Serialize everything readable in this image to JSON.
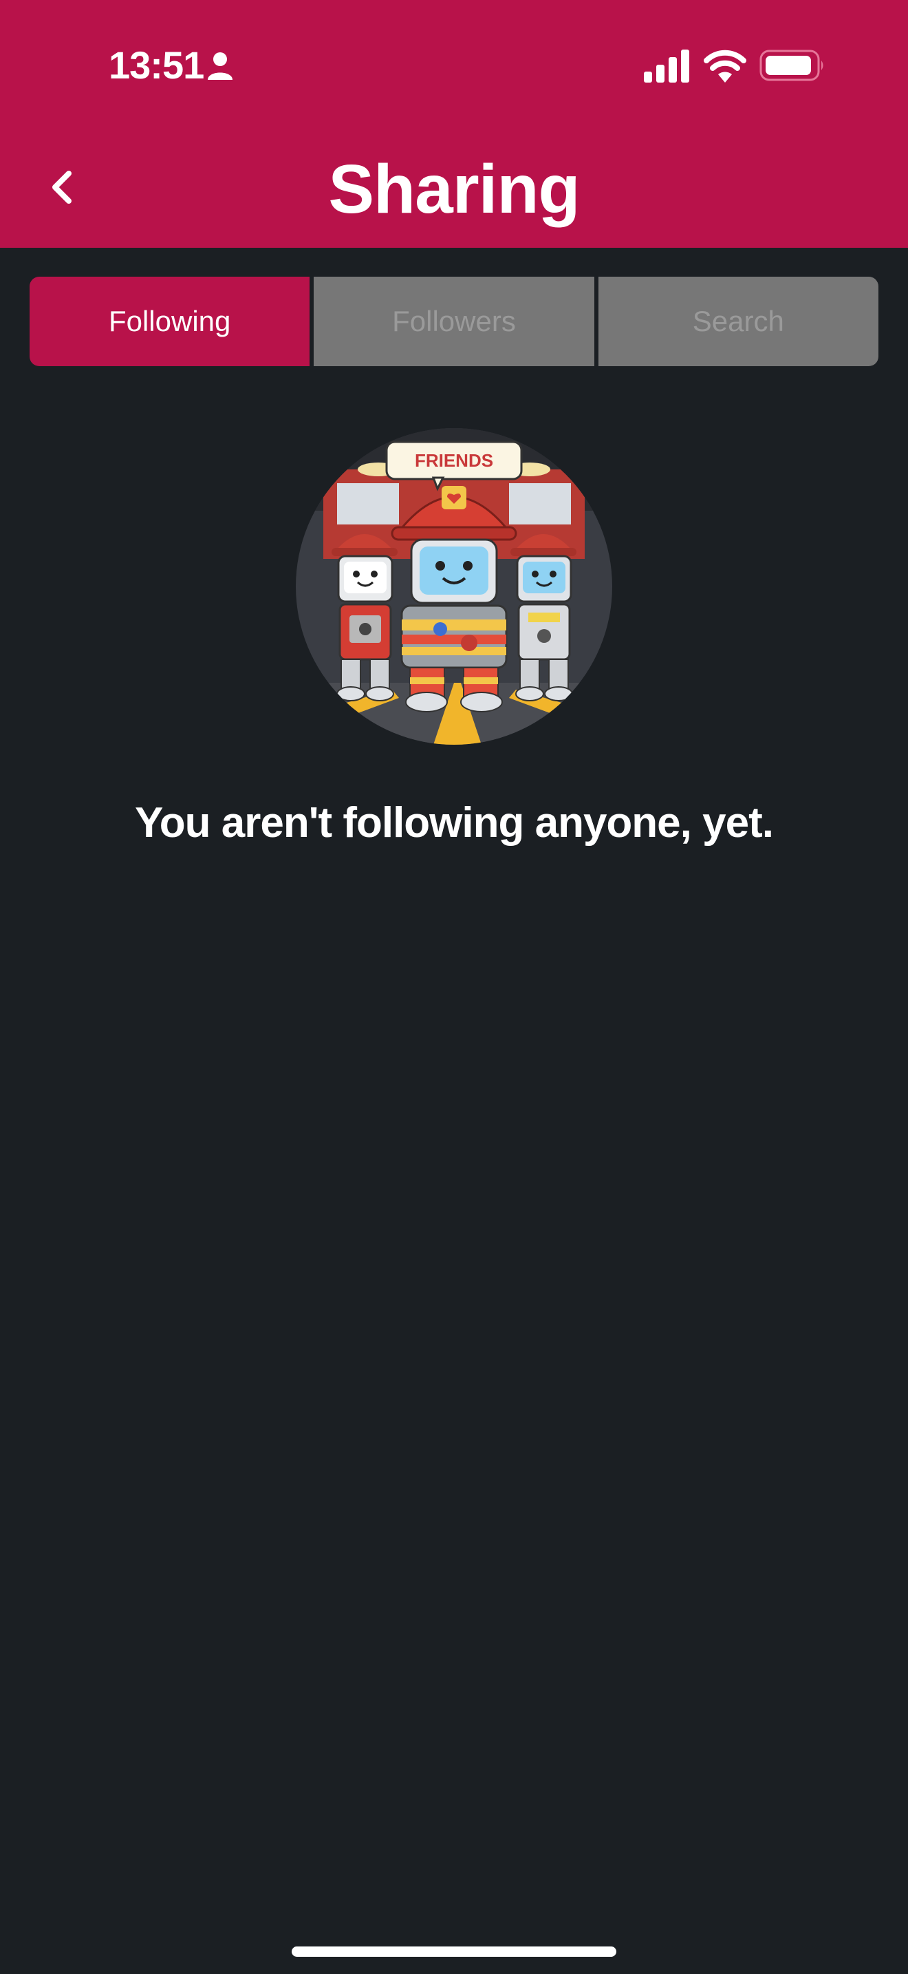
{
  "status_bar": {
    "time": "13:51"
  },
  "header": {
    "title": "Sharing",
    "color": "#b8124a"
  },
  "tabs": [
    {
      "label": "Following",
      "active": true
    },
    {
      "label": "Followers",
      "active": false
    },
    {
      "label": "Search",
      "active": false
    }
  ],
  "illustration": {
    "speech_bubble_text": "FRIENDS",
    "icon": "firefighter-robots-illustration"
  },
  "main": {
    "empty_message": "You aren't following anyone, yet."
  },
  "icons": {
    "back": "chevron-left-icon",
    "person": "person-icon",
    "signal": "cellular-signal-icon",
    "wifi": "wifi-icon",
    "battery": "battery-icon"
  }
}
